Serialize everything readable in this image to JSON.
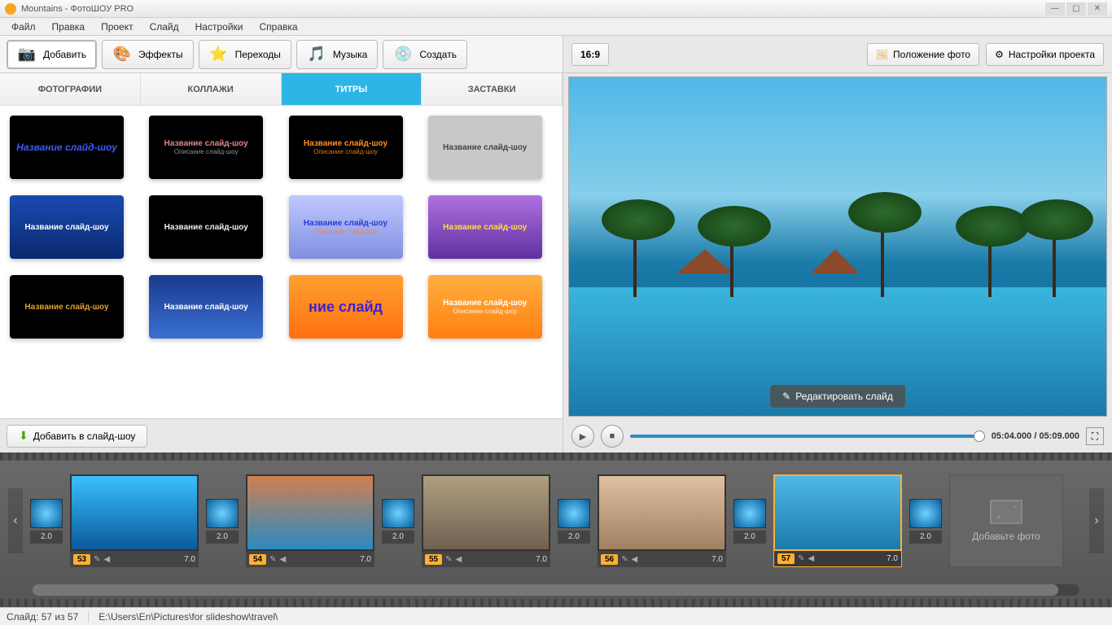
{
  "window": {
    "title": "Mountains - ФотоШОУ PRO"
  },
  "menu": [
    "Файл",
    "Правка",
    "Проект",
    "Слайд",
    "Настройки",
    "Справка"
  ],
  "ribbon": [
    {
      "label": "Добавить",
      "icon": "📷"
    },
    {
      "label": "Эффекты",
      "icon": "🎨"
    },
    {
      "label": "Переходы",
      "icon": "⭐"
    },
    {
      "label": "Музыка",
      "icon": "🎵"
    },
    {
      "label": "Создать",
      "icon": "💿"
    }
  ],
  "subtabs": [
    "ФОТОГРАФИИ",
    "КОЛЛАЖИ",
    "ТИТРЫ",
    "ЗАСТАВКИ"
  ],
  "active_subtab": 2,
  "titles": [
    {
      "bg": "#000",
      "l1": "Название слайд-шоу",
      "l2": "",
      "c1": "#3a5aff",
      "style": "italic"
    },
    {
      "bg": "#000",
      "l1": "Название слайд-шоу",
      "l2": "Описание слайд-шоу",
      "c1": "#d88",
      "c2": "#aaa"
    },
    {
      "bg": "#000",
      "l1": "Название слайд-шоу",
      "l2": "Описание слайд-шоу",
      "c1": "#ff9020",
      "c2": "#ff9020"
    },
    {
      "bg": "#c8c8c8",
      "l1": "Название слайд-шоу",
      "l2": "",
      "c1": "#444"
    },
    {
      "bg": "linear-gradient(#1a4ab0,#0a2a70)",
      "l1": "Название слайд-шоу",
      "l2": "",
      "c1": "#fff"
    },
    {
      "bg": "#000",
      "l1": "Название слайд-шоу",
      "l2": "",
      "c1": "#eee"
    },
    {
      "bg": "linear-gradient(#c0c8ff,#8090e0)",
      "l1": "Название слайд-шоу",
      "l2": "Описание слайд-шоу",
      "c1": "#2a3ad0",
      "c2": "#ff8020"
    },
    {
      "bg": "linear-gradient(#b070e0,#6030a0)",
      "l1": "Название слайд-шоу",
      "l2": "",
      "c1": "#ffdf40"
    },
    {
      "bg": "#000",
      "l1": "Название слайд-шоу",
      "l2": "",
      "c1": "#e0a030"
    },
    {
      "bg": "linear-gradient(#1a3a90,#3a70d0)",
      "l1": "Название слайд-шоу",
      "l2": "",
      "c1": "#fff"
    },
    {
      "bg": "linear-gradient(#ffa030,#ff7010)",
      "l1": "ние слайд",
      "l2": "",
      "c1": "#4020d0",
      "style": "big"
    },
    {
      "bg": "linear-gradient(#ffb040,#ff8010)",
      "l1": "Название слайд-шоу",
      "l2": "Описание слайд-шоу",
      "c1": "#fff",
      "c2": "#fff"
    }
  ],
  "add_to_slideshow": "Добавить в слайд-шоу",
  "right_top": {
    "aspect": "16:9",
    "photo_pos": "Положение фото",
    "proj_settings": "Настройки проекта"
  },
  "edit_slide": "Редактировать слайд",
  "playback": {
    "time": "05:04.000 / 05:09.000"
  },
  "timeline": {
    "trans_dur": "2.0",
    "slides": [
      {
        "num": "53",
        "dur": "7.0",
        "bg": "linear-gradient(#3ac0ff,#0a5a9a)"
      },
      {
        "num": "54",
        "dur": "7.0",
        "bg": "linear-gradient(#d08050,#2a8ac0)"
      },
      {
        "num": "55",
        "dur": "7.0",
        "bg": "linear-gradient(#b0a080,#706050)"
      },
      {
        "num": "56",
        "dur": "7.0",
        "bg": "linear-gradient(#e0c0a0,#a08060)"
      },
      {
        "num": "57",
        "dur": "7.0",
        "bg": "linear-gradient(#4fb8e8,#1a7aa8)",
        "selected": true
      }
    ],
    "add_label": "Добавьте фото"
  },
  "status": {
    "slide": "Слайд: 57 из 57",
    "path": "E:\\Users\\En\\Pictures\\for slideshow\\travel\\"
  }
}
